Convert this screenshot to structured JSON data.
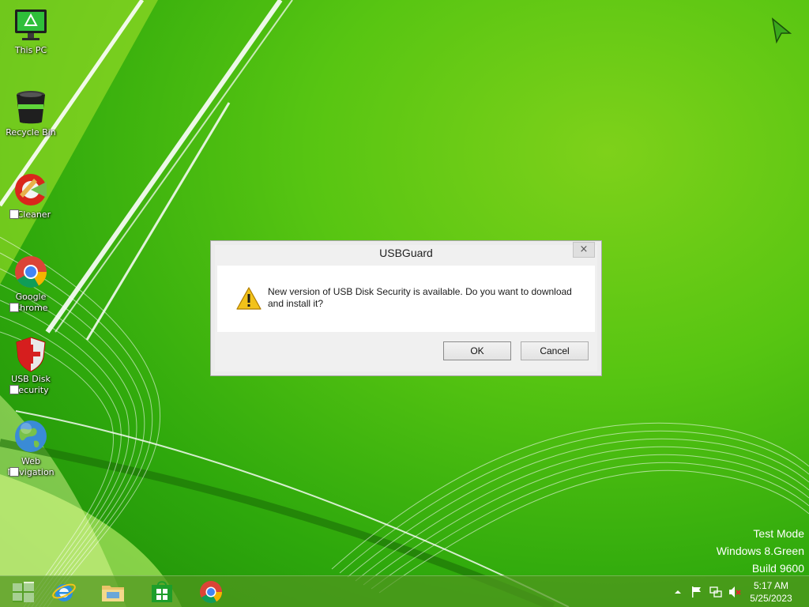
{
  "desktop": {
    "icons": [
      {
        "label": "This PC",
        "icon": "monitor-icon"
      },
      {
        "label": "Recycle Bin",
        "icon": "recycle-bin-icon"
      },
      {
        "label": "CCleaner",
        "icon": "ccleaner-icon"
      },
      {
        "label": "Google Chrome",
        "icon": "chrome-icon"
      },
      {
        "label": "USB Disk Security",
        "icon": "shield-icon"
      },
      {
        "label": "Web Navigation",
        "icon": "globe-icon"
      }
    ],
    "watermark": {
      "line1": "Test Mode",
      "line2": "Windows 8.Green",
      "line3": "Build 9600"
    }
  },
  "dialog": {
    "title": "USBGuard",
    "close_glyph": "×",
    "message": "New version of USB Disk Security is available. Do you want to download and install it?",
    "icon": "warning-icon",
    "ok_label": "OK",
    "cancel_label": "Cancel"
  },
  "taskbar": {
    "buttons": [
      {
        "name": "start",
        "icon": "windows-logo-icon"
      },
      {
        "name": "internet-explorer",
        "icon": "internet-explorer-icon"
      },
      {
        "name": "file-explorer",
        "icon": "folder-icon"
      },
      {
        "name": "store",
        "icon": "store-icon"
      },
      {
        "name": "chrome",
        "icon": "chrome-icon"
      }
    ],
    "tray": {
      "icons": [
        "chevron-up-icon",
        "flag-icon",
        "network-icon",
        "speaker-muted-icon"
      ],
      "time": "5:17 AM",
      "date": "5/25/2023"
    }
  },
  "colors": {
    "wallpaper_green": "#57c512",
    "taskbar_green": "#50961e",
    "dialog_background": "#f0f0f0",
    "warning_yellow": "#f2c21a"
  }
}
